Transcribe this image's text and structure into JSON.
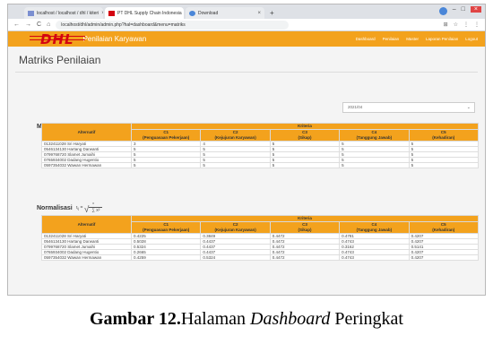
{
  "browser": {
    "tabs": [
      {
        "label": "localhost / localhost / dhl / kiteri",
        "active": false
      },
      {
        "label": "PT DHL Supply Chain Indonesia",
        "active": true
      },
      {
        "label": "Download",
        "active": false
      }
    ],
    "url": "localhost/dhl/admin/admin.php?hal=dashboard&menu=matriks"
  },
  "nav": {
    "logo": "DHL",
    "app_title": "Penilaian Karyawan",
    "menu": [
      "Dashboard",
      "Penilaian",
      "Master",
      "Laporan Penilaian",
      "Logout"
    ]
  },
  "page": {
    "title": "Matriks Penilaian",
    "period_select": "2021/04"
  },
  "matriks": {
    "title": "Matriks",
    "alt_header": "Alternatif",
    "criteria_header": "Kriteria",
    "columns": [
      {
        "code": "C1",
        "name": "(Penguasaan Pekerjaan)"
      },
      {
        "code": "C2",
        "name": "(Kejujuran Karyawan)"
      },
      {
        "code": "C3",
        "name": "(Sikap)"
      },
      {
        "code": "C4",
        "name": "(Tanggung Jawab)"
      },
      {
        "code": "C5",
        "name": "(Kehadiran)"
      }
    ],
    "rows": [
      {
        "alt": "0132411028 Sri Haryati",
        "values": [
          "3",
          "4",
          "5",
          "5",
          "5"
        ]
      },
      {
        "alt": "0546134130 Hartang Darwanti",
        "values": [
          "5",
          "5",
          "5",
          "5",
          "5"
        ]
      },
      {
        "alt": "0799768720 Slamet Jumaihi",
        "values": [
          "5",
          "5",
          "5",
          "5",
          "5"
        ]
      },
      {
        "alt": "0765934002 Dadang Hugentio",
        "values": [
          "5",
          "5",
          "5",
          "5",
          "5"
        ]
      },
      {
        "alt": "0597354032 Wawan Hermawan",
        "values": [
          "5",
          "5",
          "5",
          "5",
          "5"
        ]
      }
    ]
  },
  "normalisasi": {
    "title": "Normalisasi",
    "alt_header": "Alternatif",
    "criteria_header": "Kriteria",
    "columns": [
      {
        "code": "C1",
        "name": "(Penguasaan Pekerjaan)"
      },
      {
        "code": "C2",
        "name": "(Kejujuran Karyawan)"
      },
      {
        "code": "C3",
        "name": "(Sikap)"
      },
      {
        "code": "C4",
        "name": "(Tanggung Jawab)"
      },
      {
        "code": "C5",
        "name": "(Kehadiran)"
      }
    ],
    "rows": [
      {
        "alt": "0132411028 Sri Haryati",
        "values": [
          "0.4225",
          "0.3849",
          "0.4472",
          "0.4781",
          "0.4207"
        ]
      },
      {
        "alt": "0546134130 Hartang Darwanti",
        "values": [
          "0.5028",
          "0.4437",
          "0.4472",
          "0.4743",
          "0.4207"
        ]
      },
      {
        "alt": "0799768720 Slamet Jumaihi",
        "values": [
          "0.5324",
          "0.4437",
          "0.4472",
          "0.3162",
          "0.5141"
        ]
      },
      {
        "alt": "0765934002 Dadang Hugentio",
        "values": [
          "0.2665",
          "0.4437",
          "0.4472",
          "0.4743",
          "0.4207"
        ]
      },
      {
        "alt": "0597354032 Wawan Hermawan",
        "values": [
          "0.4259",
          "0.5324",
          "0.4472",
          "0.4743",
          "0.4207"
        ]
      }
    ]
  },
  "caption": {
    "prefix": "Gambar 12.",
    "text_a": "Halaman ",
    "italic": "Dashboard",
    "text_b": " Peringkat"
  },
  "colors": {
    "accent": "#f3a21d",
    "logo": "#d40511"
  }
}
